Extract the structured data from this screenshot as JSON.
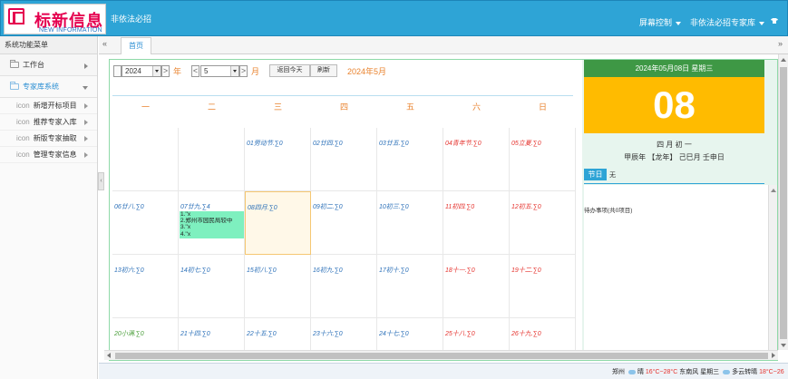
{
  "header": {
    "logo_title": "标新信息",
    "logo_sub": "NEW INFORMATION",
    "system_name": "非依法必招",
    "menu_screen": "屏幕控制",
    "menu_expert": "非依法必招专家库"
  },
  "sidebar": {
    "title": "系统功能菜单",
    "groups": [
      {
        "label": "工作台"
      },
      {
        "label": "专家库系统"
      }
    ],
    "items": [
      {
        "icon": "icon",
        "label": "新增开标项目"
      },
      {
        "icon": "icon",
        "label": "推荐专家入库"
      },
      {
        "icon": "icon",
        "label": "新版专家抽取"
      },
      {
        "icon": "icon",
        "label": "管理专家信息"
      }
    ]
  },
  "tabs": {
    "home": "首页"
  },
  "calendar": {
    "year_value": "2024",
    "year_unit": "年",
    "month_value": "5",
    "month_unit": "月",
    "prev": "<",
    "next": ">",
    "btn_today": "返回今天",
    "btn_refresh": "刷新",
    "current_month": "2024年5月",
    "weekdays": [
      "一",
      "二",
      "三",
      "四",
      "五",
      "六",
      "日"
    ],
    "weeks": [
      [
        {
          "label": ""
        },
        {
          "label": ""
        },
        {
          "label": "01劳动节.∑0",
          "color": "blue"
        },
        {
          "label": "02廿四.∑0",
          "color": "blue"
        },
        {
          "label": "03廿五.∑0",
          "color": "blue"
        },
        {
          "label": "04青年节.∑0",
          "color": "red"
        },
        {
          "label": "05立夏.∑0",
          "color": "red"
        }
      ],
      [
        {
          "label": "06廿八.∑0",
          "color": "blue"
        },
        {
          "label": "07廿九.∑4",
          "color": "blue",
          "events": [
            "1.''x",
            "2.郑州市园民局较中",
            "3.''x",
            "4.''x"
          ]
        },
        {
          "label": "08四月.∑0",
          "color": "blue",
          "today": true
        },
        {
          "label": "09初二.∑0",
          "color": "blue"
        },
        {
          "label": "10初三.∑0",
          "color": "blue"
        },
        {
          "label": "11初四.∑0",
          "color": "red"
        },
        {
          "label": "12初五.∑0",
          "color": "red"
        }
      ],
      [
        {
          "label": "13初六.∑0",
          "color": "blue"
        },
        {
          "label": "14初七.∑0",
          "color": "blue"
        },
        {
          "label": "15初八.∑0",
          "color": "blue"
        },
        {
          "label": "16初九.∑0",
          "color": "blue"
        },
        {
          "label": "17初十.∑0",
          "color": "blue"
        },
        {
          "label": "18十一.∑0",
          "color": "red"
        },
        {
          "label": "19十二.∑0",
          "color": "red"
        }
      ],
      [
        {
          "label": "20小满.∑0",
          "color": "green"
        },
        {
          "label": "21十四.∑0",
          "color": "blue"
        },
        {
          "label": "22十五.∑0",
          "color": "blue"
        },
        {
          "label": "23十六.∑0",
          "color": "blue"
        },
        {
          "label": "24十七.∑0",
          "color": "blue"
        },
        {
          "label": "25十八.∑0",
          "color": "red"
        },
        {
          "label": "26十九.∑0",
          "color": "red"
        }
      ]
    ]
  },
  "right_panel": {
    "date_line": "2024年05月08日 星期三",
    "day": "08",
    "lunar": "四 月 初 一",
    "ganzhi": "甲辰年 【龙年】 己巳月 壬申日",
    "festival_label": "节日",
    "festival_value": "无",
    "todo": "待办事项(共0项目)"
  },
  "statusbar": {
    "city": "郑州",
    "w1": "晴",
    "t1": "16°C~28°C",
    "wind": "东南风",
    "weekday": "星期三",
    "w2": "多云转晴",
    "t2": "18°C~26"
  },
  "colors": {
    "header_blue": "#2ea4d6",
    "accent_orange": "#e9822d",
    "green_bar": "#3e9845",
    "day_yellow": "#ffbb00",
    "event_green": "#7ef0bf"
  }
}
